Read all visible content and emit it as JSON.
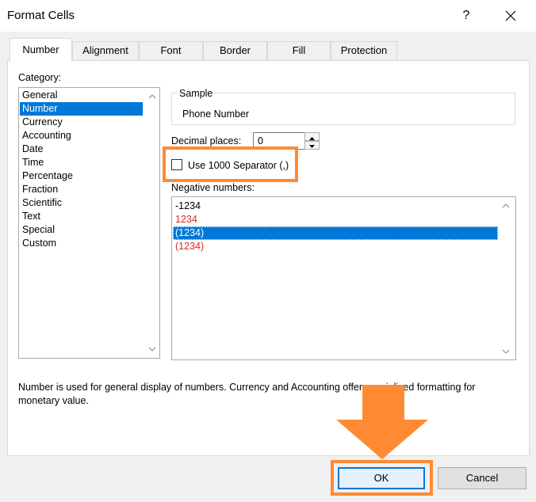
{
  "window": {
    "title": "Format Cells",
    "help_label": "?"
  },
  "tabs": [
    {
      "label": "Number",
      "active": true
    },
    {
      "label": "Alignment"
    },
    {
      "label": "Font"
    },
    {
      "label": "Border"
    },
    {
      "label": "Fill"
    },
    {
      "label": "Protection"
    }
  ],
  "category": {
    "label": "Category:",
    "items": [
      "General",
      "Number",
      "Currency",
      "Accounting",
      "Date",
      "Time",
      "Percentage",
      "Fraction",
      "Scientific",
      "Text",
      "Special",
      "Custom"
    ],
    "selected": "Number"
  },
  "sample": {
    "legend": "Sample",
    "value": "Phone Number"
  },
  "decimal_places": {
    "label": "Decimal places:",
    "value": "0"
  },
  "separator": {
    "label": "Use 1000 Separator (,)",
    "checked": false
  },
  "negative_numbers": {
    "label": "Negative numbers:",
    "items": [
      "-1234",
      "1234",
      "(1234)",
      "(1234)"
    ],
    "selected": "(1234)"
  },
  "description": "Number is used for general display of numbers.  Currency and Accounting offer specialized formatting for monetary value.",
  "buttons": {
    "ok": "OK",
    "cancel": "Cancel"
  },
  "colors": {
    "highlight": "#ff8a33",
    "selection": "#0078d7",
    "negative_red": "#d9262c"
  }
}
